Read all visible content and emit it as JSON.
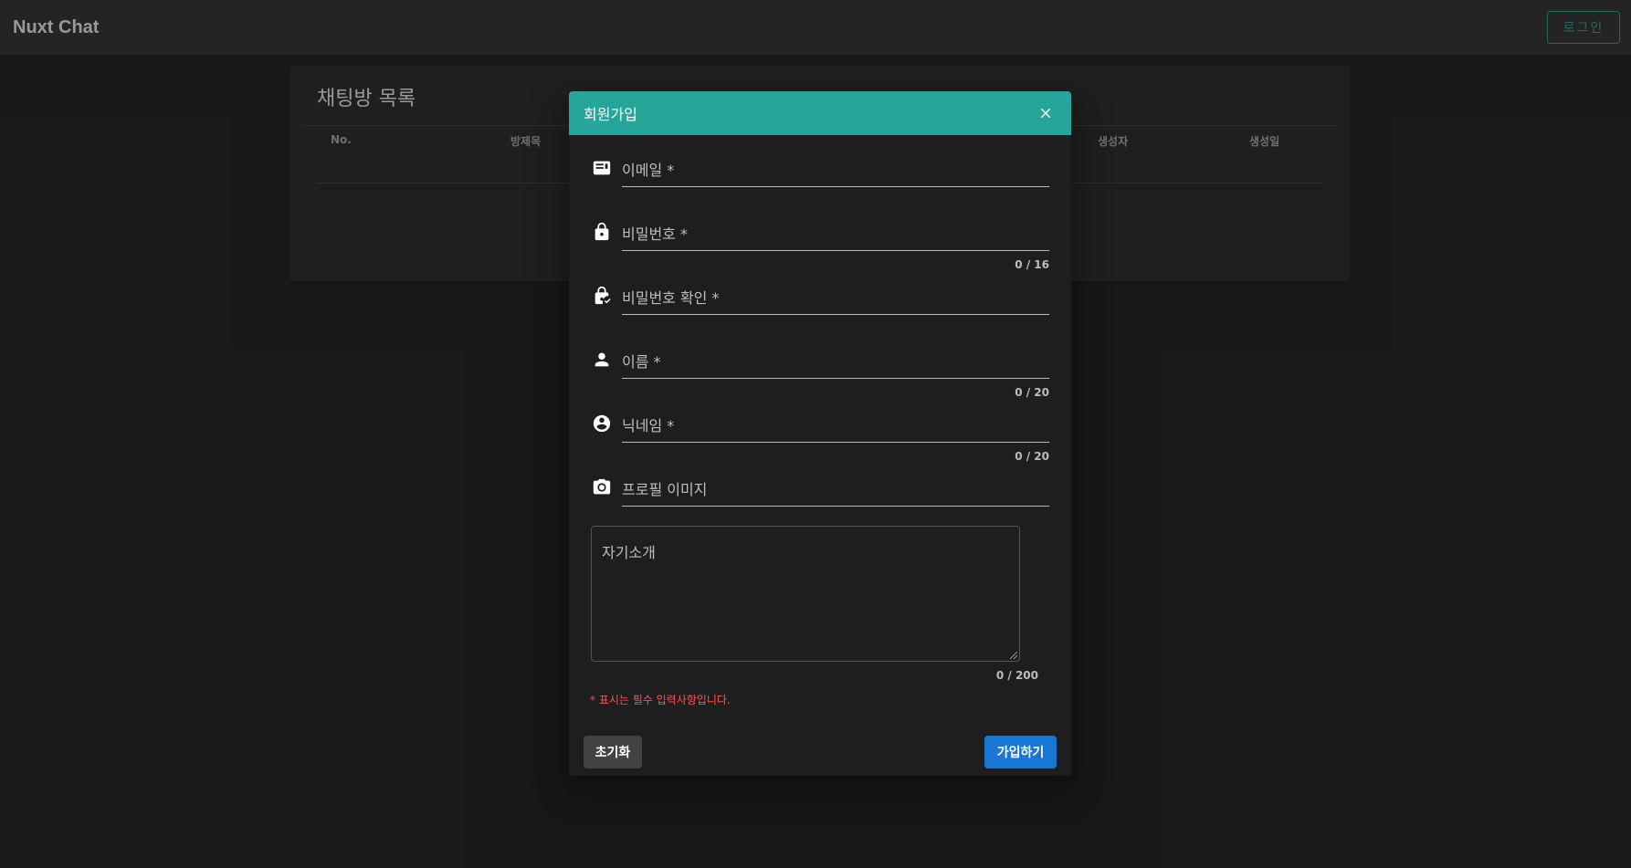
{
  "app": {
    "title": "Nuxt Chat",
    "login_label": "로그인"
  },
  "room_list": {
    "title": "채팅방 목록",
    "columns": [
      "No.",
      "방제목",
      "생성자",
      "생성일"
    ]
  },
  "dialog": {
    "title": "회원가입",
    "fields": [
      {
        "label": "이메일 *",
        "icon": "email-card-icon",
        "counter": ""
      },
      {
        "label": "비밀번호 *",
        "icon": "lock-icon",
        "counter": "0 / 16"
      },
      {
        "label": "비밀번호 확인 *",
        "icon": "lock-check-icon",
        "counter": ""
      },
      {
        "label": "이름 *",
        "icon": "person-icon",
        "counter": "0 / 20"
      },
      {
        "label": "닉네임 *",
        "icon": "account-circle-icon",
        "counter": "0 / 20"
      },
      {
        "label": "프로필 이미지",
        "icon": "camera-icon",
        "counter": ""
      }
    ],
    "textarea": {
      "label": "자기소개",
      "counter": "0 / 200"
    },
    "required_note": "* 표시는 필수 입력사항입니다.",
    "reset_label": "초기화",
    "submit_label": "가입하기"
  },
  "colors": {
    "header": "#26a69a",
    "submit": "#1976d2",
    "error": "#ff5252"
  }
}
